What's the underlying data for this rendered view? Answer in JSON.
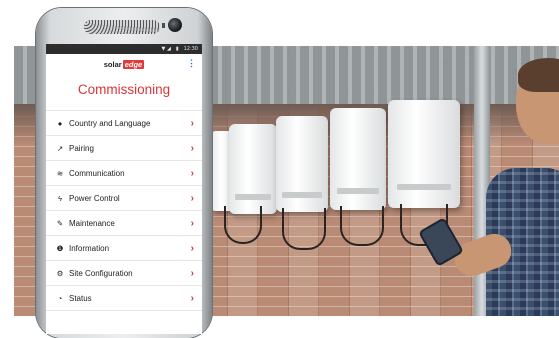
{
  "status_bar": {
    "signal_icon": "signal-icon",
    "battery_icon": "battery-icon",
    "time": "12:30"
  },
  "app": {
    "logo_text_main": "solar",
    "logo_text_accent": "edge",
    "menu_icon": "kebab-menu-icon",
    "title": "Commissioning"
  },
  "menu": {
    "items": [
      {
        "label": "Country and Language",
        "icon": "globe-icon"
      },
      {
        "label": "Pairing",
        "icon": "pairing-icon"
      },
      {
        "label": "Communication",
        "icon": "wifi-icon"
      },
      {
        "label": "Power Control",
        "icon": "bolt-icon"
      },
      {
        "label": "Maintenance",
        "icon": "wrench-icon"
      },
      {
        "label": "Information",
        "icon": "info-icon"
      },
      {
        "label": "Site Configuration",
        "icon": "gears-icon"
      },
      {
        "label": "Status",
        "icon": "dashboard-icon"
      }
    ],
    "chevron": "›"
  },
  "colors": {
    "accent": "#d9343a",
    "menu_dots": "#2a6fdb",
    "status_bar": "#2d2d2d"
  }
}
